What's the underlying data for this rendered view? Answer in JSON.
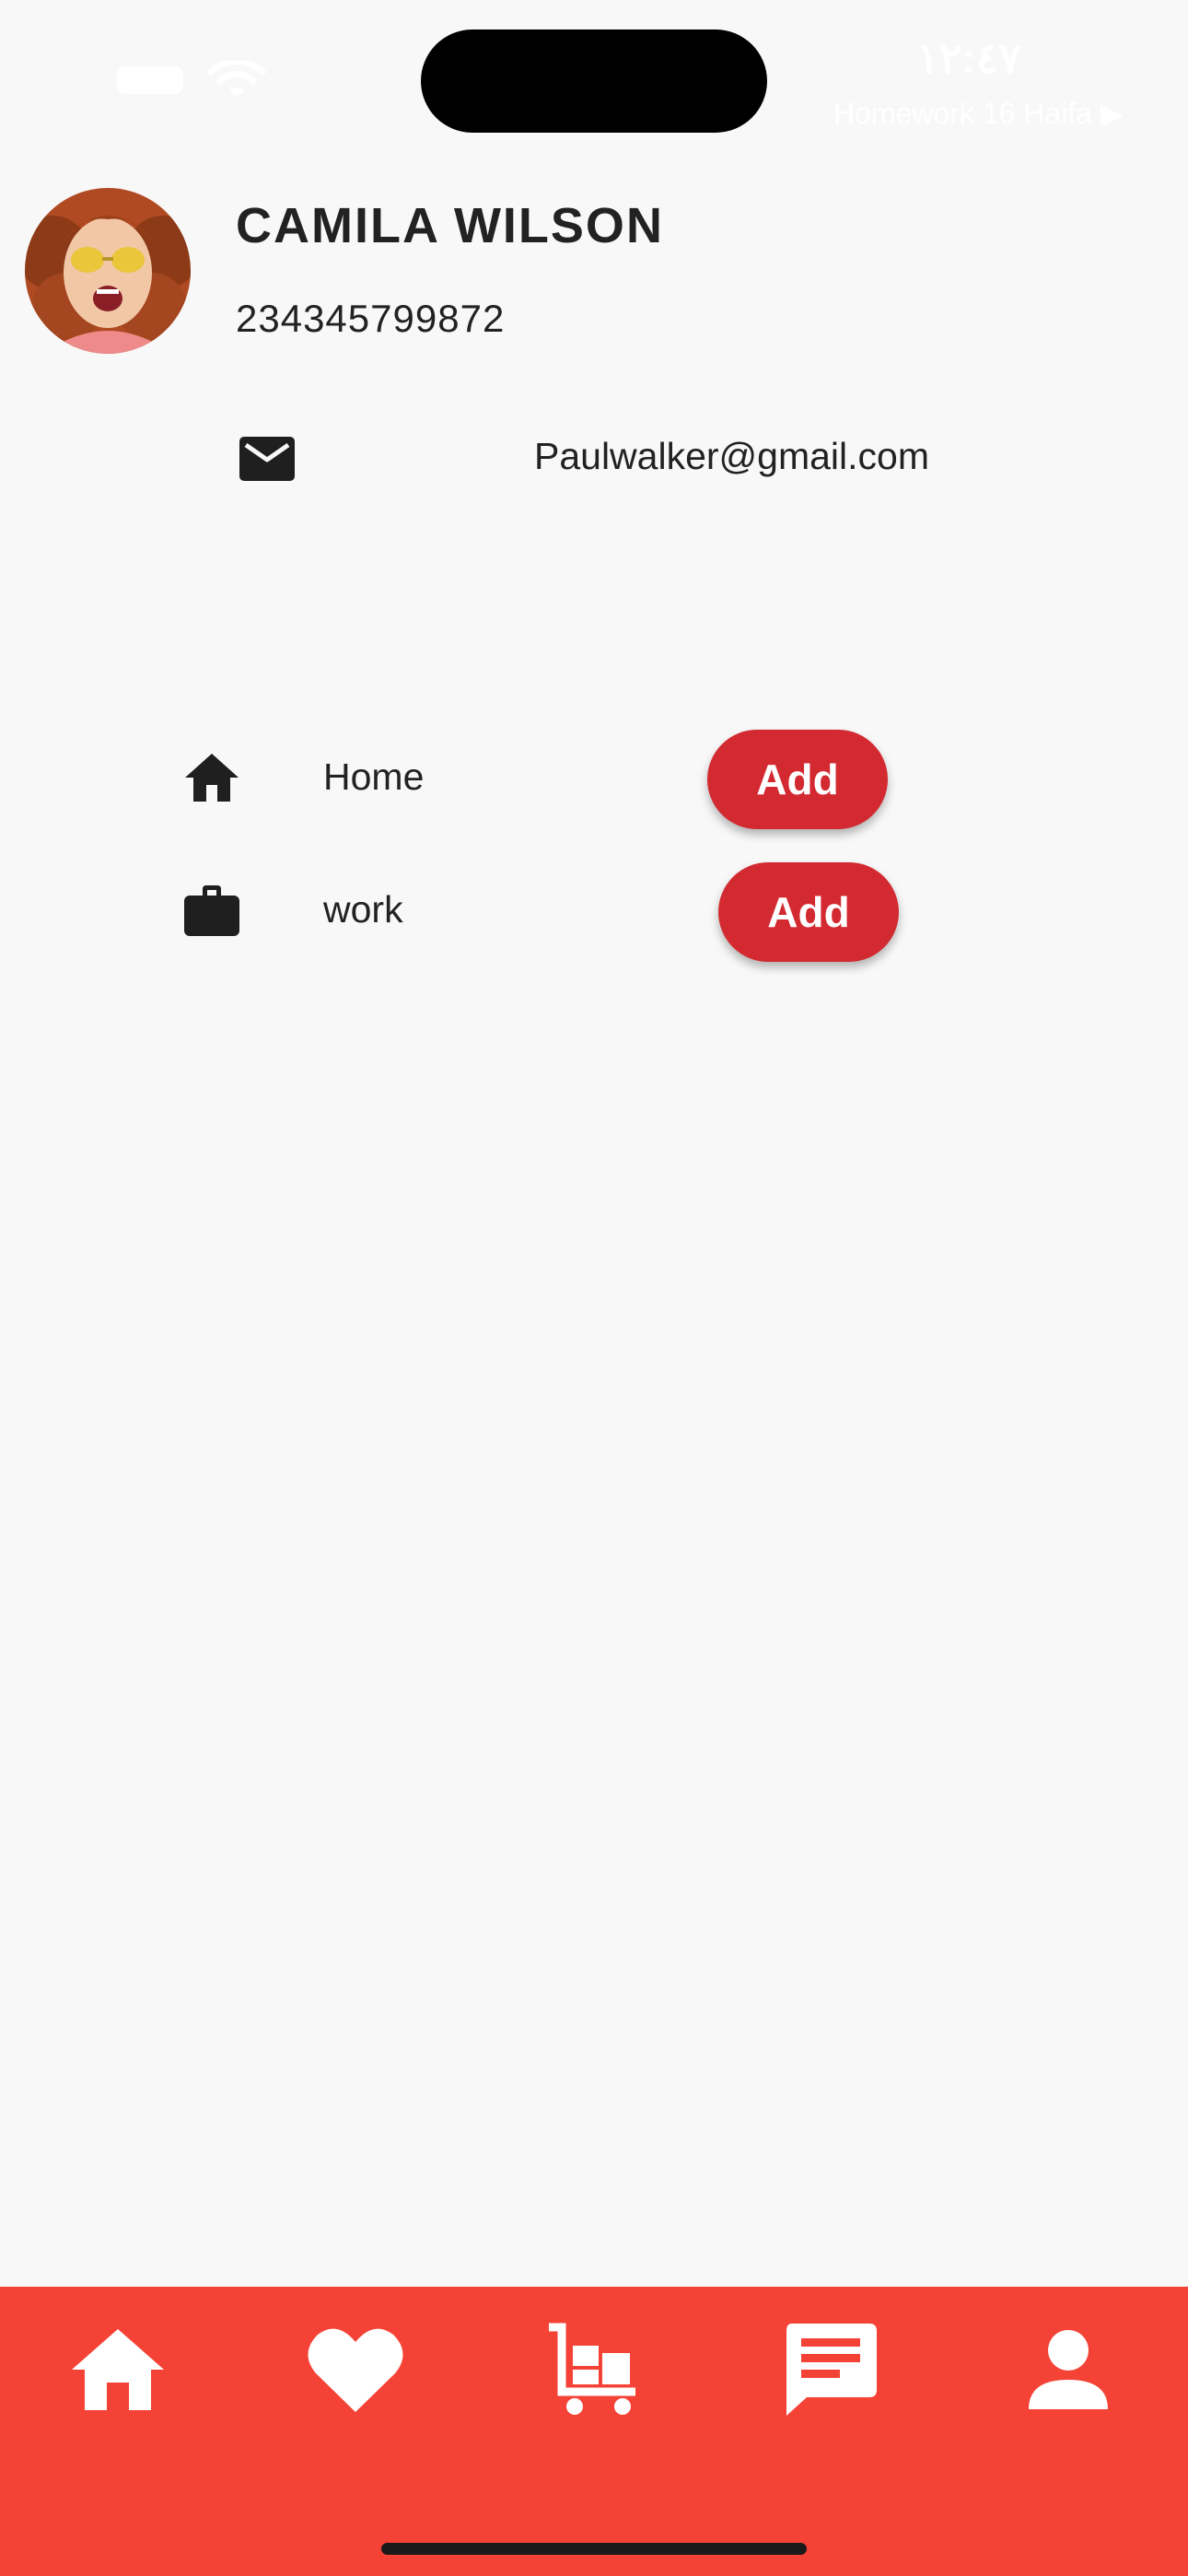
{
  "status_bar": {
    "time": "١٢:٤٧",
    "back_app_label": "Homework 16 Haifa ▶"
  },
  "profile": {
    "name": "CAMILA WILSON",
    "phone": "234345799872",
    "email": "Paulwalker@gmail.com"
  },
  "addresses": [
    {
      "label": "Home",
      "icon": "home-icon",
      "button_label": "Add"
    },
    {
      "label": "work",
      "icon": "briefcase-icon",
      "button_label": "Add"
    }
  ],
  "bottom_nav": {
    "items": [
      "home-icon",
      "heart-icon",
      "cart-icon",
      "chat-icon",
      "person-icon"
    ],
    "background": "#f44336"
  },
  "colors": {
    "accent": "#d32a31",
    "background": "#f8f8f8"
  }
}
